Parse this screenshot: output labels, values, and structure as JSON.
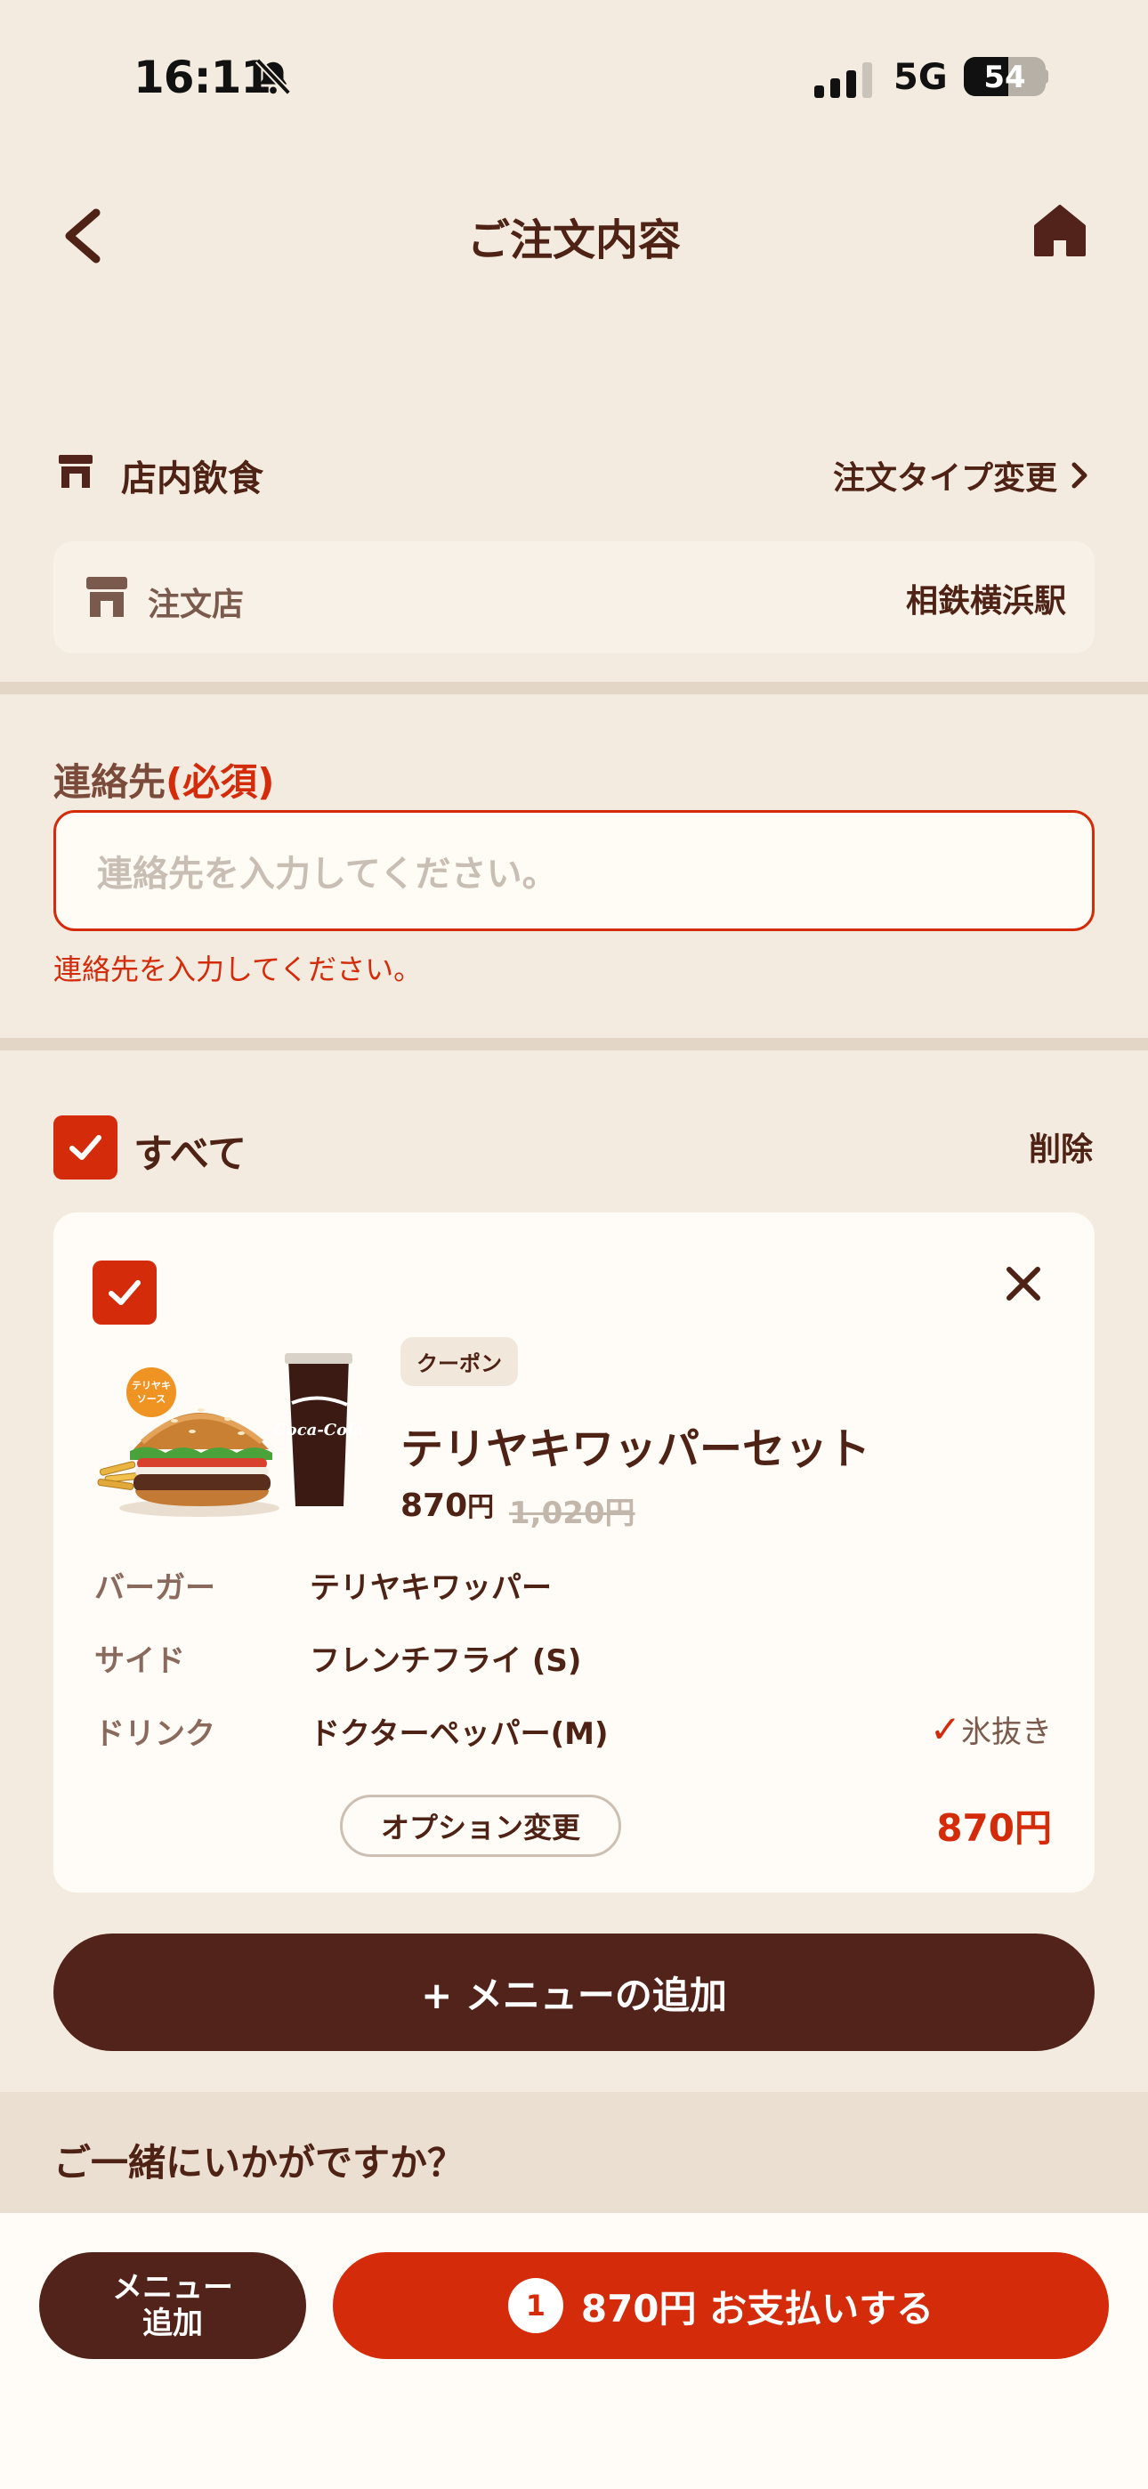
{
  "status_bar": {
    "time": "16:11",
    "network": "5G",
    "battery": "54"
  },
  "header": {
    "title": "ご注文内容"
  },
  "order_type": {
    "label": "店内飲食",
    "change_label": "注文タイプ変更",
    "store_label": "注文店",
    "store_value": "相鉄横浜駅"
  },
  "contact": {
    "title": "連絡先",
    "required": "(必須)",
    "placeholder": "連絡先を入力してください。",
    "error": "連絡先を入力してください。"
  },
  "cart": {
    "select_all_label": "すべて",
    "delete_label": "削除",
    "items": [
      {
        "badge": "クーポン",
        "name": "テリヤキワッパーセット",
        "price": "870",
        "price_unit": "円",
        "original_price": "1,020円",
        "options": [
          {
            "label": "バーガー",
            "value": "テリヤキワッパー"
          },
          {
            "label": "サイド",
            "value": "フレンチフライ (S)"
          },
          {
            "label": "ドリンク",
            "value": "ドクターペッパー(M)"
          }
        ],
        "drink_note_check": "✓",
        "drink_note": "氷抜き",
        "option_change_label": "オプション変更",
        "total": "870円",
        "image_labels": {
          "sauce": "テリヤキソース",
          "cup": "Coca-Cola"
        }
      }
    ],
    "add_menu_label": "+ メニューの追加"
  },
  "suggestions": {
    "title": "ご一緒にいかがですか？"
  },
  "bottom_bar": {
    "menu_add_line1": "メニュー",
    "menu_add_line2": "追加",
    "count": "1",
    "pay_label": "870円 お支払いする"
  },
  "colors": {
    "brown": "#52231a",
    "red": "#d42b0a",
    "background": "#f3ebdf"
  }
}
